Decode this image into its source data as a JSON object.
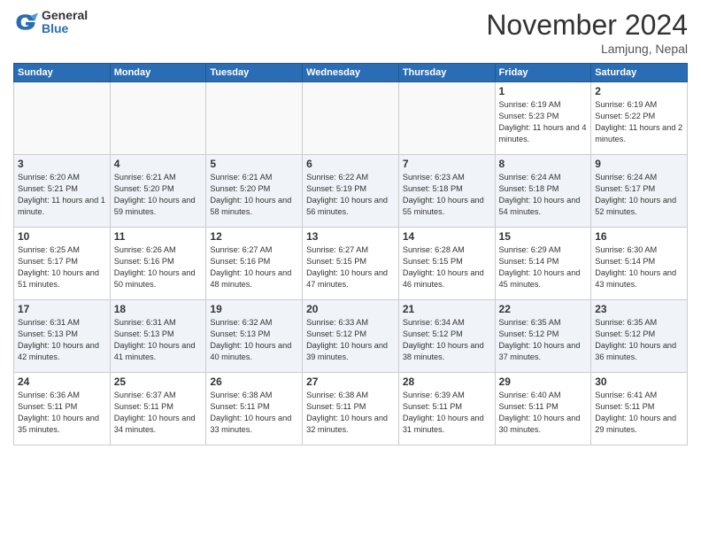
{
  "logo": {
    "general": "General",
    "blue": "Blue"
  },
  "header": {
    "month": "November 2024",
    "location": "Lamjung, Nepal"
  },
  "weekdays": [
    "Sunday",
    "Monday",
    "Tuesday",
    "Wednesday",
    "Thursday",
    "Friday",
    "Saturday"
  ],
  "weeks": [
    [
      {
        "day": "",
        "empty": true
      },
      {
        "day": "",
        "empty": true
      },
      {
        "day": "",
        "empty": true
      },
      {
        "day": "",
        "empty": true
      },
      {
        "day": "",
        "empty": true
      },
      {
        "day": "1",
        "sunrise": "6:19 AM",
        "sunset": "5:23 PM",
        "daylight": "11 hours and 4 minutes."
      },
      {
        "day": "2",
        "sunrise": "6:19 AM",
        "sunset": "5:22 PM",
        "daylight": "11 hours and 2 minutes."
      }
    ],
    [
      {
        "day": "3",
        "sunrise": "6:20 AM",
        "sunset": "5:21 PM",
        "daylight": "11 hours and 1 minute."
      },
      {
        "day": "4",
        "sunrise": "6:21 AM",
        "sunset": "5:20 PM",
        "daylight": "10 hours and 59 minutes."
      },
      {
        "day": "5",
        "sunrise": "6:21 AM",
        "sunset": "5:20 PM",
        "daylight": "10 hours and 58 minutes."
      },
      {
        "day": "6",
        "sunrise": "6:22 AM",
        "sunset": "5:19 PM",
        "daylight": "10 hours and 56 minutes."
      },
      {
        "day": "7",
        "sunrise": "6:23 AM",
        "sunset": "5:18 PM",
        "daylight": "10 hours and 55 minutes."
      },
      {
        "day": "8",
        "sunrise": "6:24 AM",
        "sunset": "5:18 PM",
        "daylight": "10 hours and 54 minutes."
      },
      {
        "day": "9",
        "sunrise": "6:24 AM",
        "sunset": "5:17 PM",
        "daylight": "10 hours and 52 minutes."
      }
    ],
    [
      {
        "day": "10",
        "sunrise": "6:25 AM",
        "sunset": "5:17 PM",
        "daylight": "10 hours and 51 minutes."
      },
      {
        "day": "11",
        "sunrise": "6:26 AM",
        "sunset": "5:16 PM",
        "daylight": "10 hours and 50 minutes."
      },
      {
        "day": "12",
        "sunrise": "6:27 AM",
        "sunset": "5:16 PM",
        "daylight": "10 hours and 48 minutes."
      },
      {
        "day": "13",
        "sunrise": "6:27 AM",
        "sunset": "5:15 PM",
        "daylight": "10 hours and 47 minutes."
      },
      {
        "day": "14",
        "sunrise": "6:28 AM",
        "sunset": "5:15 PM",
        "daylight": "10 hours and 46 minutes."
      },
      {
        "day": "15",
        "sunrise": "6:29 AM",
        "sunset": "5:14 PM",
        "daylight": "10 hours and 45 minutes."
      },
      {
        "day": "16",
        "sunrise": "6:30 AM",
        "sunset": "5:14 PM",
        "daylight": "10 hours and 43 minutes."
      }
    ],
    [
      {
        "day": "17",
        "sunrise": "6:31 AM",
        "sunset": "5:13 PM",
        "daylight": "10 hours and 42 minutes."
      },
      {
        "day": "18",
        "sunrise": "6:31 AM",
        "sunset": "5:13 PM",
        "daylight": "10 hours and 41 minutes."
      },
      {
        "day": "19",
        "sunrise": "6:32 AM",
        "sunset": "5:13 PM",
        "daylight": "10 hours and 40 minutes."
      },
      {
        "day": "20",
        "sunrise": "6:33 AM",
        "sunset": "5:12 PM",
        "daylight": "10 hours and 39 minutes."
      },
      {
        "day": "21",
        "sunrise": "6:34 AM",
        "sunset": "5:12 PM",
        "daylight": "10 hours and 38 minutes."
      },
      {
        "day": "22",
        "sunrise": "6:35 AM",
        "sunset": "5:12 PM",
        "daylight": "10 hours and 37 minutes."
      },
      {
        "day": "23",
        "sunrise": "6:35 AM",
        "sunset": "5:12 PM",
        "daylight": "10 hours and 36 minutes."
      }
    ],
    [
      {
        "day": "24",
        "sunrise": "6:36 AM",
        "sunset": "5:11 PM",
        "daylight": "10 hours and 35 minutes."
      },
      {
        "day": "25",
        "sunrise": "6:37 AM",
        "sunset": "5:11 PM",
        "daylight": "10 hours and 34 minutes."
      },
      {
        "day": "26",
        "sunrise": "6:38 AM",
        "sunset": "5:11 PM",
        "daylight": "10 hours and 33 minutes."
      },
      {
        "day": "27",
        "sunrise": "6:38 AM",
        "sunset": "5:11 PM",
        "daylight": "10 hours and 32 minutes."
      },
      {
        "day": "28",
        "sunrise": "6:39 AM",
        "sunset": "5:11 PM",
        "daylight": "10 hours and 31 minutes."
      },
      {
        "day": "29",
        "sunrise": "6:40 AM",
        "sunset": "5:11 PM",
        "daylight": "10 hours and 30 minutes."
      },
      {
        "day": "30",
        "sunrise": "6:41 AM",
        "sunset": "5:11 PM",
        "daylight": "10 hours and 29 minutes."
      }
    ]
  ],
  "labels": {
    "sunrise": "Sunrise:",
    "sunset": "Sunset:",
    "daylight": "Daylight:"
  }
}
